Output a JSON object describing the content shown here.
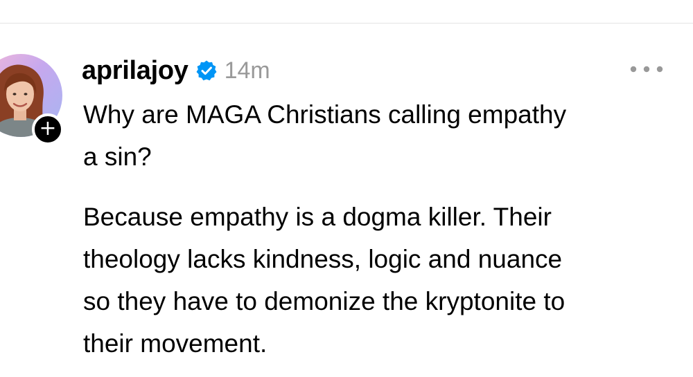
{
  "post": {
    "author": {
      "username": "aprilajoy",
      "verified": true
    },
    "timestamp": "14m",
    "paragraphs": [
      "Why are MAGA Christians calling empathy\na sin?",
      "Because empathy is a dogma killer. Their\ntheology lacks kindness, logic and nuance\nso they have to demonize the kryptonite to\ntheir movement."
    ]
  },
  "icons": {
    "follow": "plus-icon",
    "verified": "verified-badge-icon",
    "more": "more-options-icon"
  },
  "colors": {
    "text": "#000000",
    "muted": "#999999",
    "verified_blue": "#0095f6",
    "divider": "#e4e4e4"
  }
}
